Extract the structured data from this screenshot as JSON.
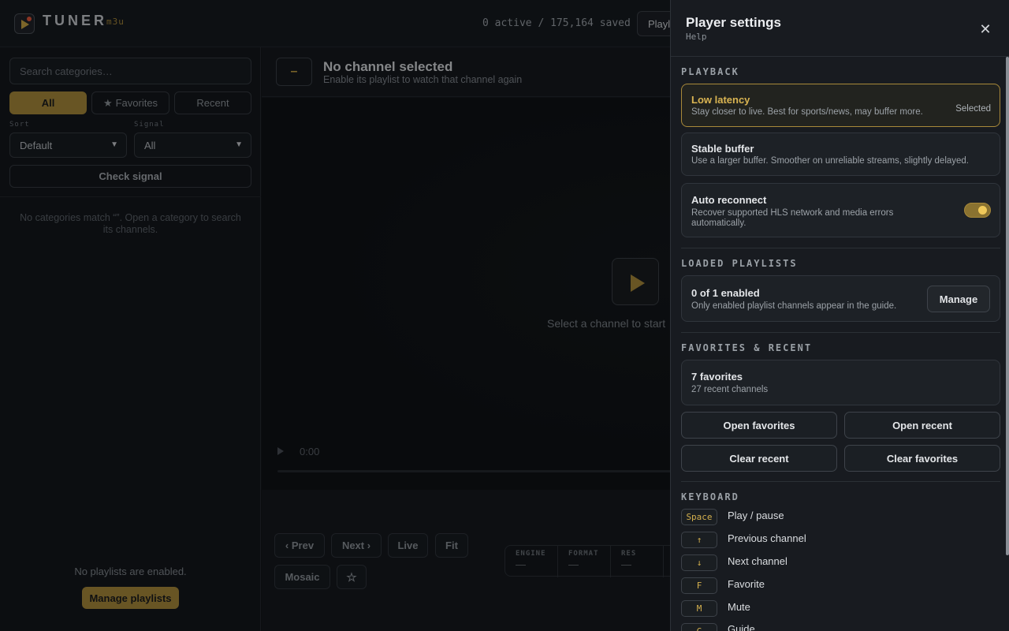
{
  "app": {
    "brand": "TUNER",
    "brand_sub": "m3u",
    "counts": "0 active / 175,164 saved",
    "top_button": "Playlists"
  },
  "sidebar": {
    "search_placeholder": "Search categories…",
    "filters": {
      "all": "All",
      "favorites": "Favorites",
      "recent": "Recent"
    },
    "sort_label": "Sort",
    "sort_value": "Default",
    "signal_label": "Signal",
    "signal_value": "All",
    "check_signal": "Check signal",
    "empty_message": "No categories match “”. Open a category to search its channels.",
    "no_playlists": "No playlists are enabled.",
    "manage_playlists": "Manage playlists"
  },
  "channel": {
    "dash": "–",
    "title": "No channel selected",
    "subtitle": "Enable its playlist to watch that channel again",
    "select_message": "Select a channel to start",
    "time": "0:00"
  },
  "controls": {
    "prev": "‹ Prev",
    "next": "Next ›",
    "live": "Live",
    "fit": "Fit",
    "mosaic": "Mosaic",
    "star": "☆"
  },
  "stats": [
    {
      "label": "ENGINE",
      "value": "—"
    },
    {
      "label": "FORMAT",
      "value": "—"
    },
    {
      "label": "RES",
      "value": "—"
    }
  ],
  "panel": {
    "title": "Player settings",
    "help": "Help",
    "close": "✕",
    "playback": {
      "title": "PLAYBACK",
      "low_latency": {
        "title": "Low latency",
        "desc": "Stay closer to live. Best for sports/news, may buffer more.",
        "tag": "Selected"
      },
      "stable_buffer": {
        "title": "Stable buffer",
        "desc": "Use a larger buffer. Smoother on unreliable streams, slightly delayed."
      },
      "auto_reconnect": {
        "title": "Auto reconnect",
        "desc": "Recover supported HLS network and media errors automatically.",
        "enabled": true
      }
    },
    "loaded_playlists": {
      "title": "LOADED PLAYLISTS",
      "status": "0 of 1 enabled",
      "desc": "Only enabled playlist channels appear in the guide.",
      "manage": "Manage"
    },
    "favorites_recent": {
      "title": "FAVORITES & RECENT",
      "favorites_count": "7 favorites",
      "recent_count": "27 recent channels",
      "open_favorites": "Open favorites",
      "open_recent": "Open recent",
      "clear_recent": "Clear recent",
      "clear_favorites": "Clear favorites"
    },
    "keyboard": {
      "title": "KEYBOARD",
      "shortcuts": [
        {
          "key": "Space",
          "action": "Play / pause"
        },
        {
          "key": "↑",
          "action": "Previous channel"
        },
        {
          "key": "↓",
          "action": "Next channel"
        },
        {
          "key": "F",
          "action": "Favorite"
        },
        {
          "key": "M",
          "action": "Mute"
        },
        {
          "key": "G",
          "action": "Guide"
        }
      ]
    }
  },
  "colors": {
    "accent": "#a8893a",
    "accent_text": "#d9b452",
    "background": "#121519",
    "panel": "#181b20"
  }
}
